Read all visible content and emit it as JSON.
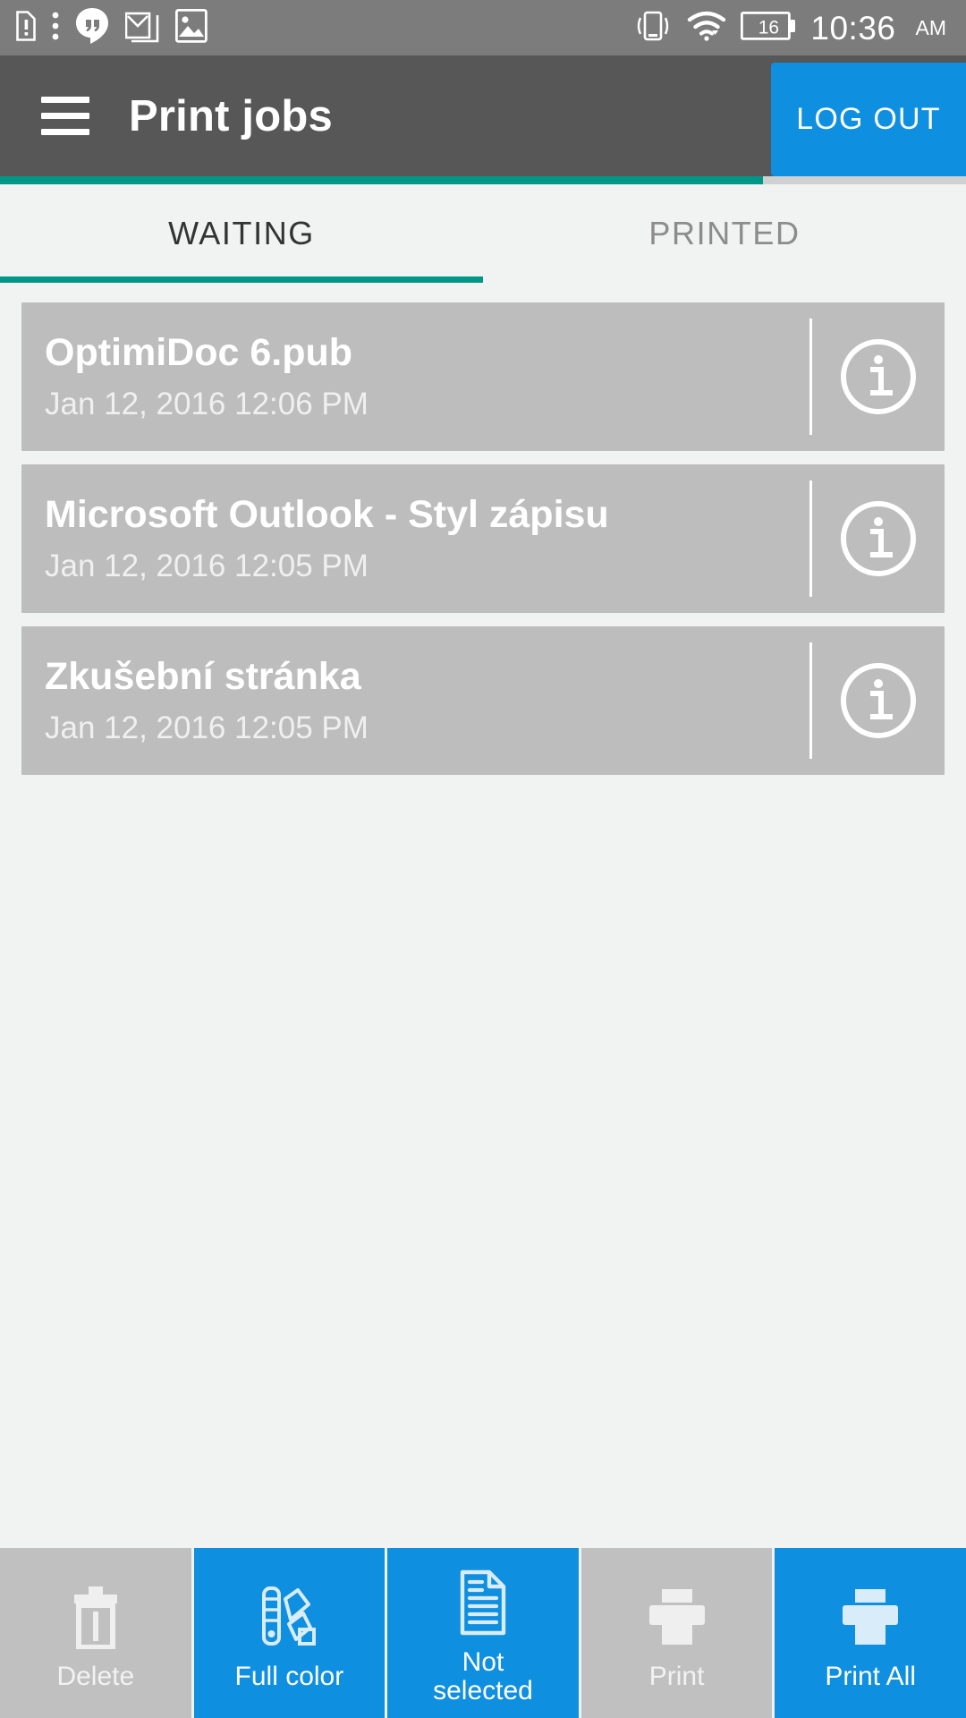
{
  "status_bar": {
    "icons_left": [
      "sim-alert-icon",
      "more-vert-icon",
      "hangouts-icon",
      "gmail-icon",
      "photos-icon"
    ],
    "icons_right": [
      "vibrate-icon",
      "wifi-icon",
      "battery-icon"
    ],
    "battery_level": "16",
    "time": "10:36",
    "ampm": "AM"
  },
  "app_bar": {
    "menu_icon": "hamburger-menu-icon",
    "title": "Print jobs",
    "logout_label": "LOG OUT",
    "accent_color": "#0f8fe0",
    "bar_color": "#575757"
  },
  "progress": {
    "value": 79,
    "color": "#009688",
    "track_color": "#cfd0d0"
  },
  "tabs": {
    "active_index": 0,
    "indicator_color": "#009688",
    "items": [
      {
        "label": "WAITING"
      },
      {
        "label": "PRINTED"
      }
    ]
  },
  "jobs": [
    {
      "name": "OptimiDoc 6.pub",
      "date": "Jan 12, 2016 12:06 PM",
      "info_icon": "info-circle-icon"
    },
    {
      "name": "Microsoft Outlook - Styl zápisu",
      "date": "Jan 12, 2016 12:05 PM",
      "info_icon": "info-circle-icon"
    },
    {
      "name": "Zkušební stránka",
      "date": "Jan 12, 2016 12:05 PM",
      "info_icon": "info-circle-icon"
    }
  ],
  "bottom_bar": {
    "buttons": [
      {
        "label": "Delete",
        "icon": "trash-icon",
        "state": "disabled"
      },
      {
        "label": "Full color",
        "icon": "color-swatch-icon",
        "state": "enabled"
      },
      {
        "label": "Not\nselected",
        "icon": "document-icon",
        "state": "enabled"
      },
      {
        "label": "Print",
        "icon": "printer-icon",
        "state": "disabled"
      },
      {
        "label": "Print All",
        "icon": "printer-icon",
        "state": "enabled"
      }
    ]
  }
}
